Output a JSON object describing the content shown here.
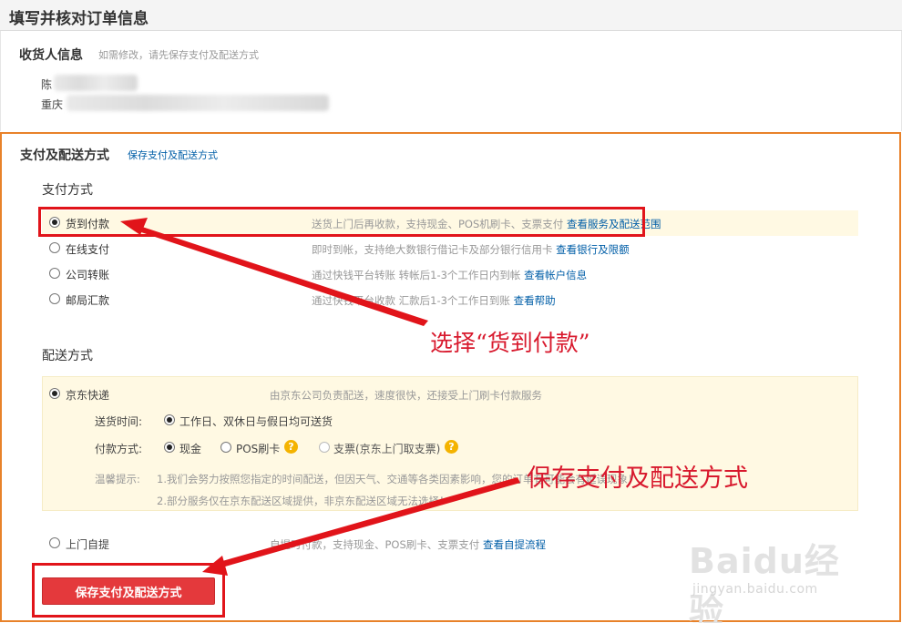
{
  "header": {
    "title": "填写并核对订单信息"
  },
  "consignee": {
    "title": "收货人信息",
    "hint": "如需修改，请先保存支付及配送方式",
    "name_prefix": "陈",
    "address_prefix": "重庆"
  },
  "payment_section": {
    "title": "支付及配送方式",
    "save_link": "保存支付及配送方式",
    "payment": {
      "title": "支付方式",
      "options": [
        {
          "label": "货到付款",
          "desc": "送货上门后再收款，支持现金、POS机刷卡、支票支付",
          "link": "查看服务及配送范围",
          "selected": true
        },
        {
          "label": "在线支付",
          "desc": "即时到帐，支持绝大数银行借记卡及部分银行信用卡",
          "link": "查看银行及限额",
          "selected": false
        },
        {
          "label": "公司转账",
          "desc": "通过快钱平台转账 转帐后1-3个工作日内到帐",
          "link": "查看帐户信息",
          "selected": false
        },
        {
          "label": "邮局汇款",
          "desc": "通过快钱平台收款 汇款后1-3个工作日到账",
          "link": "查看帮助",
          "selected": false
        }
      ]
    },
    "shipping": {
      "title": "配送方式",
      "jd": {
        "label": "京东快递",
        "desc": "由京东公司负责配送，速度很快，还接受上门刷卡付款服务",
        "time_label": "送货时间:",
        "time_option": "工作日、双休日与假日均可送货",
        "pay_label": "付款方式:",
        "pay_options": [
          "现金",
          "POS刷卡",
          "支票(京东上门取支票)"
        ],
        "tips_label": "温馨提示:",
        "tips": [
          "1.我们会努力按照您指定的时间配送，但因天气、交通等各类因素影响，您的订单有可能会有延误现象！",
          "2.部分服务仅在京东配送区域提供，非京东配送区域无法选择！"
        ]
      },
      "pickup": {
        "label": "上门自提",
        "desc": "自提时付款，支持现金、POS刷卡、支票支付",
        "link": "查看自提流程"
      }
    },
    "save_button": "保存支付及配送方式"
  },
  "annotations": {
    "select_note": "选择“货到付款”",
    "save_note": "保存支付及配送方式"
  },
  "watermark": {
    "text": "Baidu经验",
    "sub": "jingyan.baidu.com"
  },
  "colors": {
    "accent_red": "#e4393c",
    "annotation_red": "#d8192d",
    "link_blue": "#005ea7",
    "box_orange": "#e8822a",
    "highlight_bg": "#fff9e3"
  },
  "icons": [
    "radio-icon",
    "question-icon",
    "arrow-icon"
  ]
}
